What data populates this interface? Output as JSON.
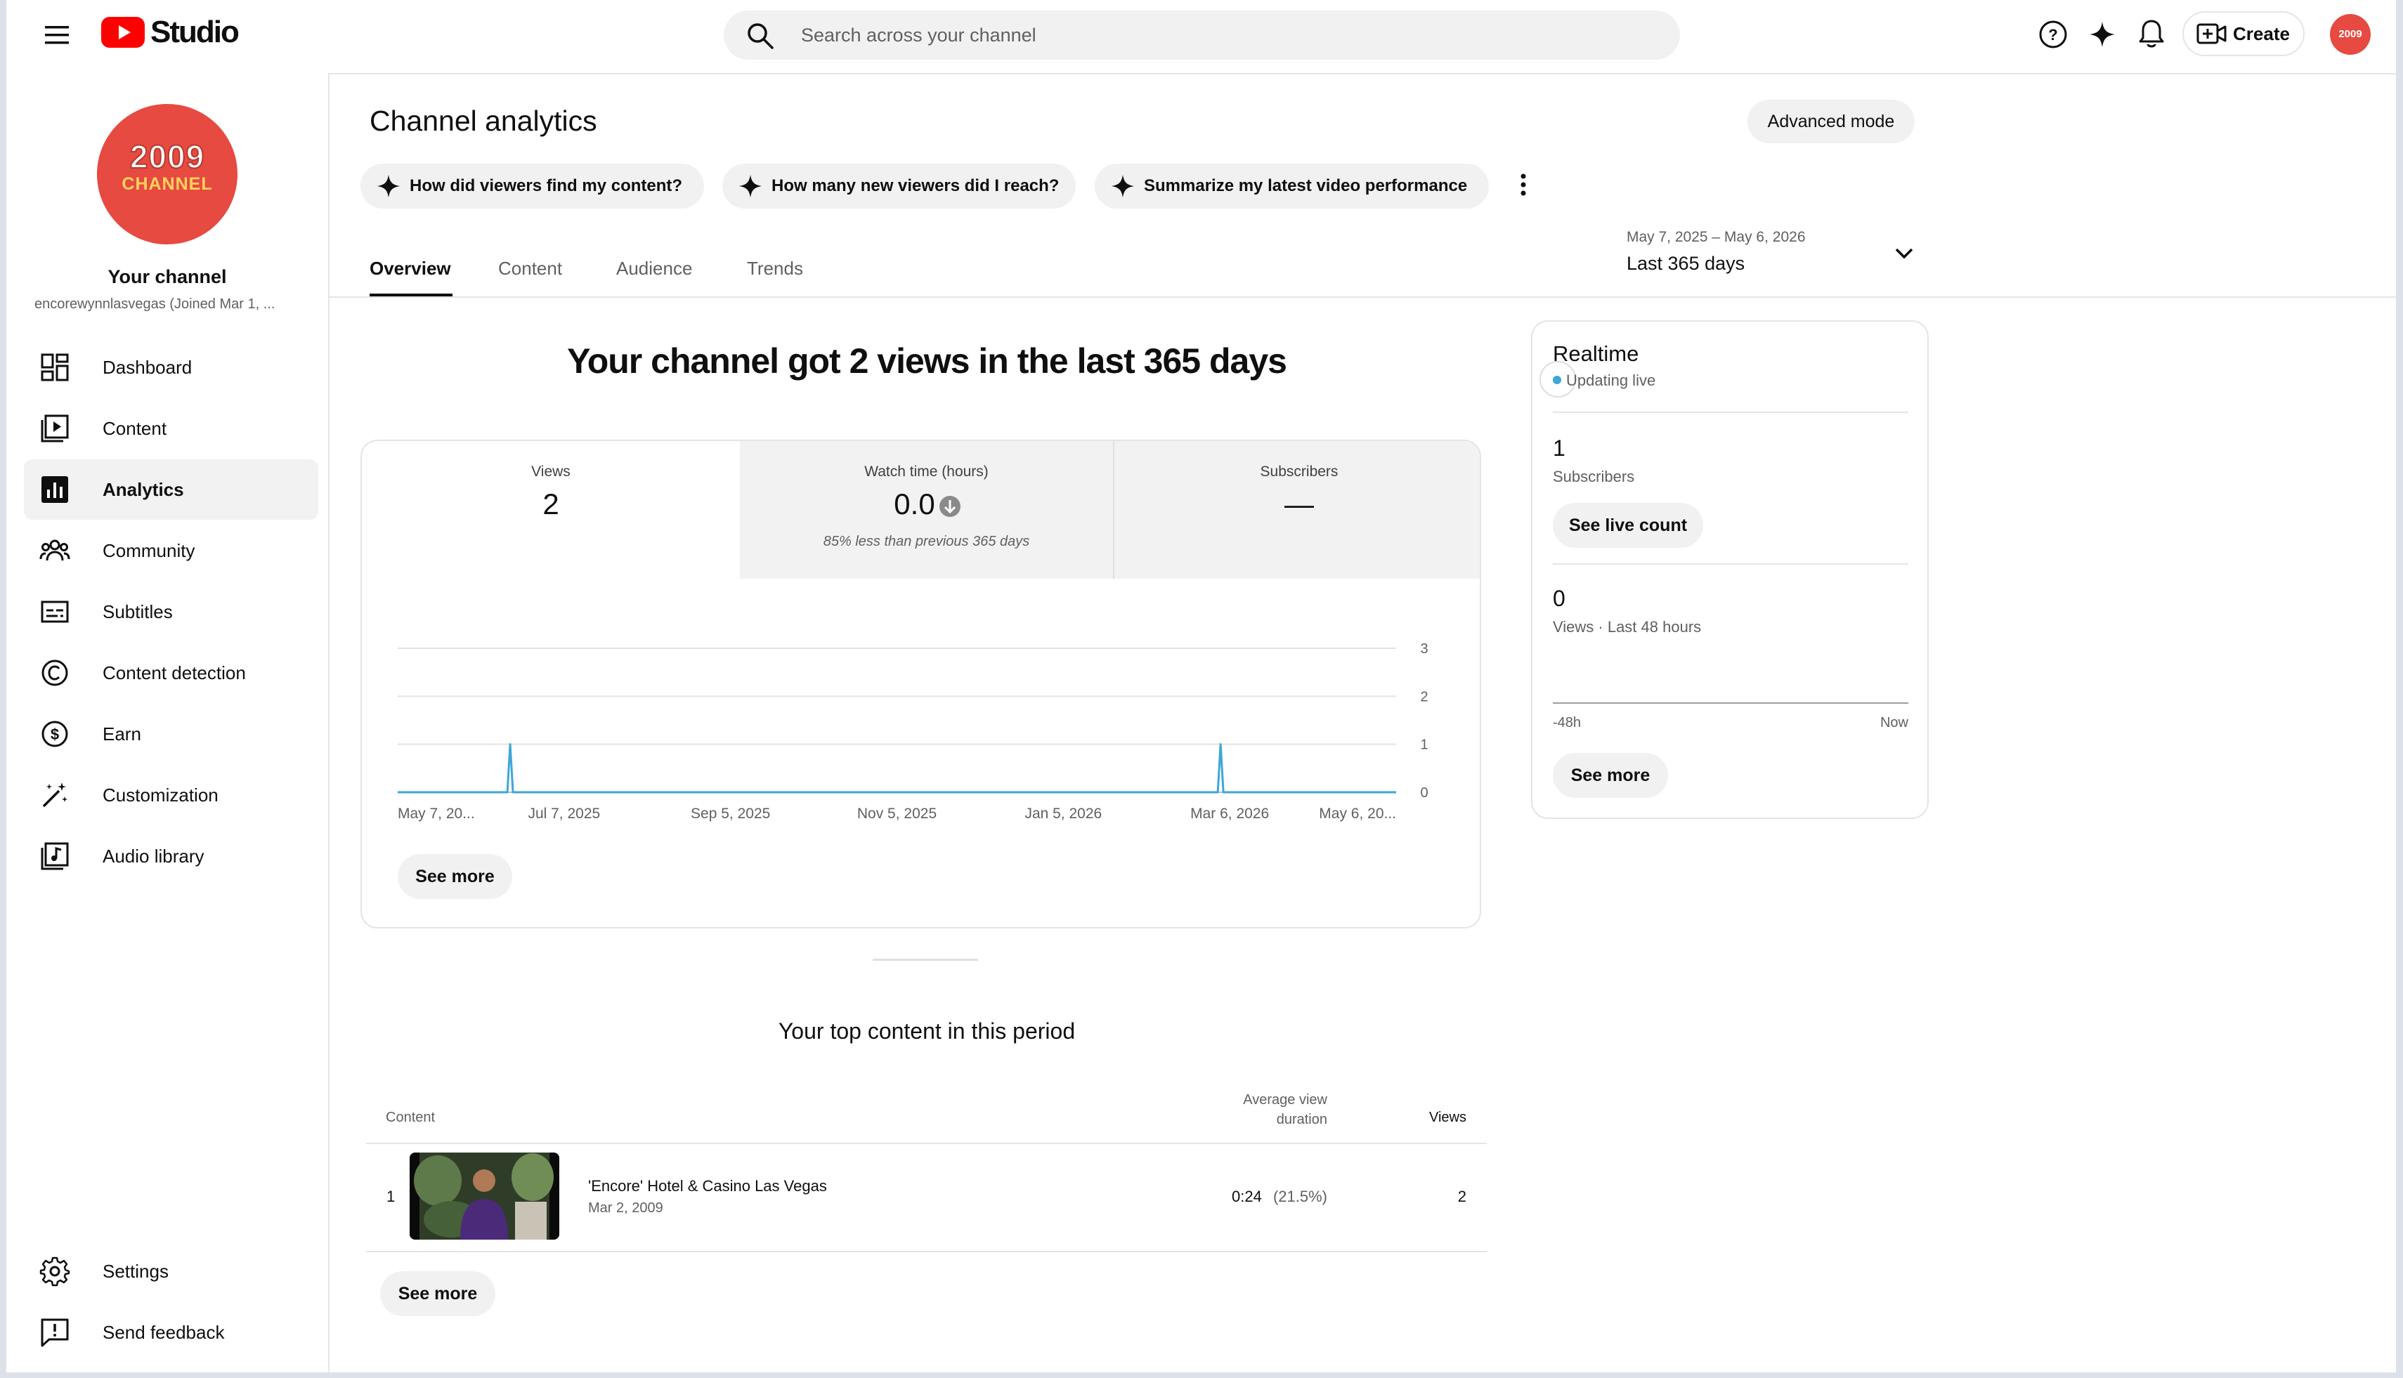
{
  "header": {
    "logo_text": "Studio",
    "search_placeholder": "Search across your channel",
    "create_label": "Create",
    "avatar_text": "2009"
  },
  "sidebar": {
    "channel_avatar_line1": "2009",
    "channel_avatar_line2": "CHANNEL",
    "channel_title": "Your channel",
    "channel_handle": "encorewynnlasvegas (Joined Mar 1, ...",
    "items": [
      {
        "label": "Dashboard",
        "icon": "dashboard-icon"
      },
      {
        "label": "Content",
        "icon": "content-icon"
      },
      {
        "label": "Analytics",
        "icon": "analytics-icon",
        "active": true
      },
      {
        "label": "Community",
        "icon": "community-icon"
      },
      {
        "label": "Subtitles",
        "icon": "subtitles-icon"
      },
      {
        "label": "Content detection",
        "icon": "copyright-icon"
      },
      {
        "label": "Earn",
        "icon": "dollar-icon"
      },
      {
        "label": "Customization",
        "icon": "magic-wand-icon"
      },
      {
        "label": "Audio library",
        "icon": "audio-library-icon"
      }
    ],
    "bottom_items": [
      {
        "label": "Settings",
        "icon": "gear-icon"
      },
      {
        "label": "Send feedback",
        "icon": "feedback-icon"
      }
    ]
  },
  "main": {
    "title": "Channel analytics",
    "advanced_mode": "Advanced mode",
    "chips": [
      "How did viewers find my content?",
      "How many new viewers did I reach?",
      "Summarize my latest video performance"
    ],
    "tabs": [
      "Overview",
      "Content",
      "Audience",
      "Trends"
    ],
    "active_tab": "Overview",
    "date_range": "May 7, 2025 – May 6, 2026",
    "date_label": "Last 365 days",
    "headline": "Your channel got 2 views in the last 365 days",
    "metrics": [
      {
        "label": "Views",
        "value": "2",
        "note": ""
      },
      {
        "label": "Watch time (hours)",
        "value": "0.0",
        "note": "85% less than previous 365 days"
      },
      {
        "label": "Subscribers",
        "value": "—",
        "note": ""
      }
    ],
    "see_more": "See more"
  },
  "chart_data": {
    "type": "line",
    "title": "",
    "xlabel": "",
    "ylabel": "",
    "ylim": [
      0,
      3
    ],
    "yticks": [
      "3",
      "2",
      "1",
      "0"
    ],
    "xtick_labels": [
      "May 7, 20...",
      "Jul 7, 2025",
      "Sep 5, 2025",
      "Nov 5, 2025",
      "Jan 5, 2026",
      "Mar 6, 2026",
      "May 6, 20..."
    ],
    "series": [
      {
        "color": "#3ea6d8",
        "points": [
          {
            "x": "2025-05-07",
            "y": 0
          },
          {
            "x": "2025-06-17",
            "y": 1
          },
          {
            "x": "2026-03-03",
            "y": 1
          },
          {
            "x": "2026-05-06",
            "y": 0
          }
        ]
      }
    ]
  },
  "realtime": {
    "title": "Realtime",
    "status": "Updating live",
    "subs_value": "1",
    "subs_label": "Subscribers",
    "live_count_btn": "See live count",
    "views_value": "0",
    "views_label": "Views · Last 48 hours",
    "axis_start": "-48h",
    "axis_end": "Now",
    "see_more": "See more"
  },
  "top_content": {
    "title": "Your top content in this period",
    "col_content": "Content",
    "col_avg_line1": "Average view",
    "col_avg_line2": "duration",
    "col_views": "Views",
    "rows": [
      {
        "rank": "1",
        "title": "'Encore' Hotel & Casino Las Vegas",
        "date": "Mar 2, 2009",
        "avg_duration": "0:24",
        "avg_pct": "(21.5%)",
        "views": "2"
      }
    ],
    "see_more": "See more"
  },
  "colors": {
    "brand_red": "#ff0000",
    "avatar_red": "#e64a41",
    "line_blue": "#3ea6d8",
    "live_dot": "#3ea6d8"
  }
}
